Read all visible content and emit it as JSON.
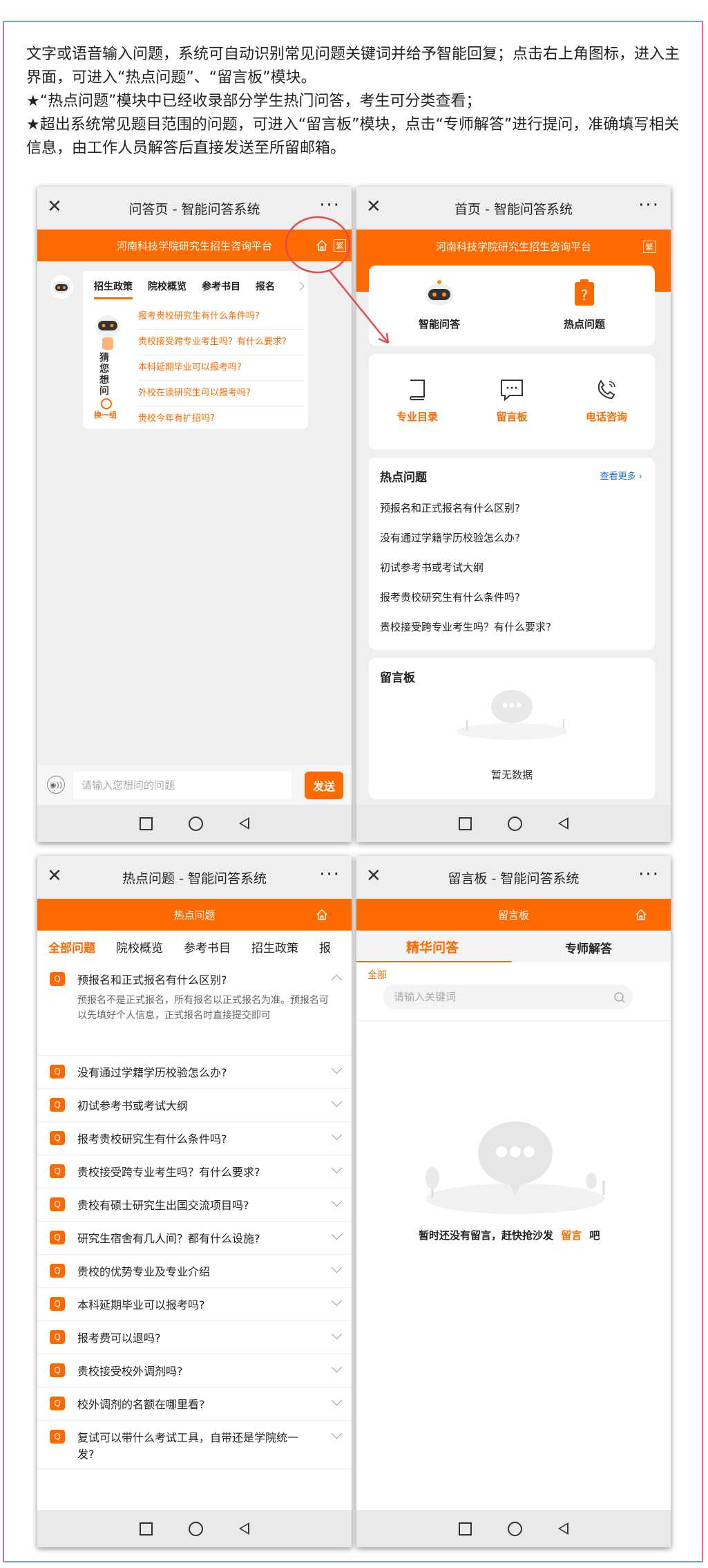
{
  "intro": {
    "line1": "文字或语音输入问题，系统可自动识别常见问题关键词并给予智能回复；点击右上角图标，进入主界面，可进入“热点问题”、“留言板”模块。",
    "line2": "★“热点问题”模块中已经收录部分学生热门问答，考生可分类查看；",
    "line3": "★超出系统常见题目范围的问题，可进入“留言板”模块，点击“专师解答”进行提问，准确填写相关信息，由工作人员解答后直接发送至所留邮箱。"
  },
  "colors": {
    "accent": "#ff6a00",
    "highlight_circle": "#e5484d",
    "link": "#1e6fd9"
  },
  "phone1": {
    "title": "问答页 - 智能问答系统",
    "banner": "河南科技学院研究生招生咨询平台",
    "fan": "繁",
    "tabs": [
      "招生政策",
      "院校概览",
      "参考书目",
      "报名"
    ],
    "guess_label": [
      "猜",
      "您",
      "想",
      "问"
    ],
    "refresh": "换一组",
    "questions": [
      "报考贵校研究生有什么条件吗?",
      "贵校接受跨专业考生吗？有什么要求?",
      "本科延期毕业可以报考吗?",
      "外校在读研究生可以报考吗?",
      "贵校今年有扩招吗?"
    ],
    "input_placeholder": "请输入您想问的问题",
    "send": "发送",
    "voice": "◉))"
  },
  "phone2": {
    "title": "首页 - 智能问答系统",
    "banner": "河南科技学院研究生招生咨询平台",
    "fan": "繁",
    "top_tiles": [
      "智能问答",
      "热点问题"
    ],
    "mid_tiles": [
      "专业目录",
      "留言板",
      "电话咨询"
    ],
    "hot_title": "热点问题",
    "more": "查看更多 ›",
    "hot_items": [
      "预报名和正式报名有什么区别?",
      "没有通过学籍学历校验怎么办?",
      "初试参考书或考试大纲",
      "报考贵校研究生有什么条件吗?",
      "贵校接受跨专业考生吗？有什么要求?"
    ],
    "board_title": "留言板",
    "empty": "暂无数据"
  },
  "phone3": {
    "title": "热点问题 - 智能问答系统",
    "banner": "热点问题",
    "cats": [
      "全部问题",
      "院校概览",
      "参考书目",
      "招生政策",
      "报"
    ],
    "badge": "Q",
    "first_q": "预报名和正式报名有什么区别?",
    "first_a": "预报名不是正式报名，所有报名以正式报名为准。预报名可以先填好个人信息，正式报名时直接提交即可",
    "faqs": [
      "没有通过学籍学历校验怎么办?",
      "初试参考书或考试大纲",
      "报考贵校研究生有什么条件吗?",
      "贵校接受跨专业考生吗？有什么要求?",
      "贵校有硕士研究生出国交流项目吗?",
      "研究生宿舍有几人间？都有什么设施?",
      "贵校的优势专业及专业介绍",
      "本科延期毕业可以报考吗?",
      "报考费可以退吗?",
      "贵校接受校外调剂吗?",
      "校外调剂的名额在哪里看?"
    ],
    "last_q1": "复试可以带什么考试工具，自带还是学院统一",
    "last_q2": "发?"
  },
  "phone4": {
    "title": "留言板 - 智能问答系统",
    "banner": "留言板",
    "tab_active": "精华问答",
    "tab_other": "专师解答",
    "filter": "全部",
    "search_placeholder": "请输入关键词",
    "empty_pre": "暂时还没有留言，赶快抢沙发",
    "empty_link": "留言",
    "empty_post": "吧"
  }
}
